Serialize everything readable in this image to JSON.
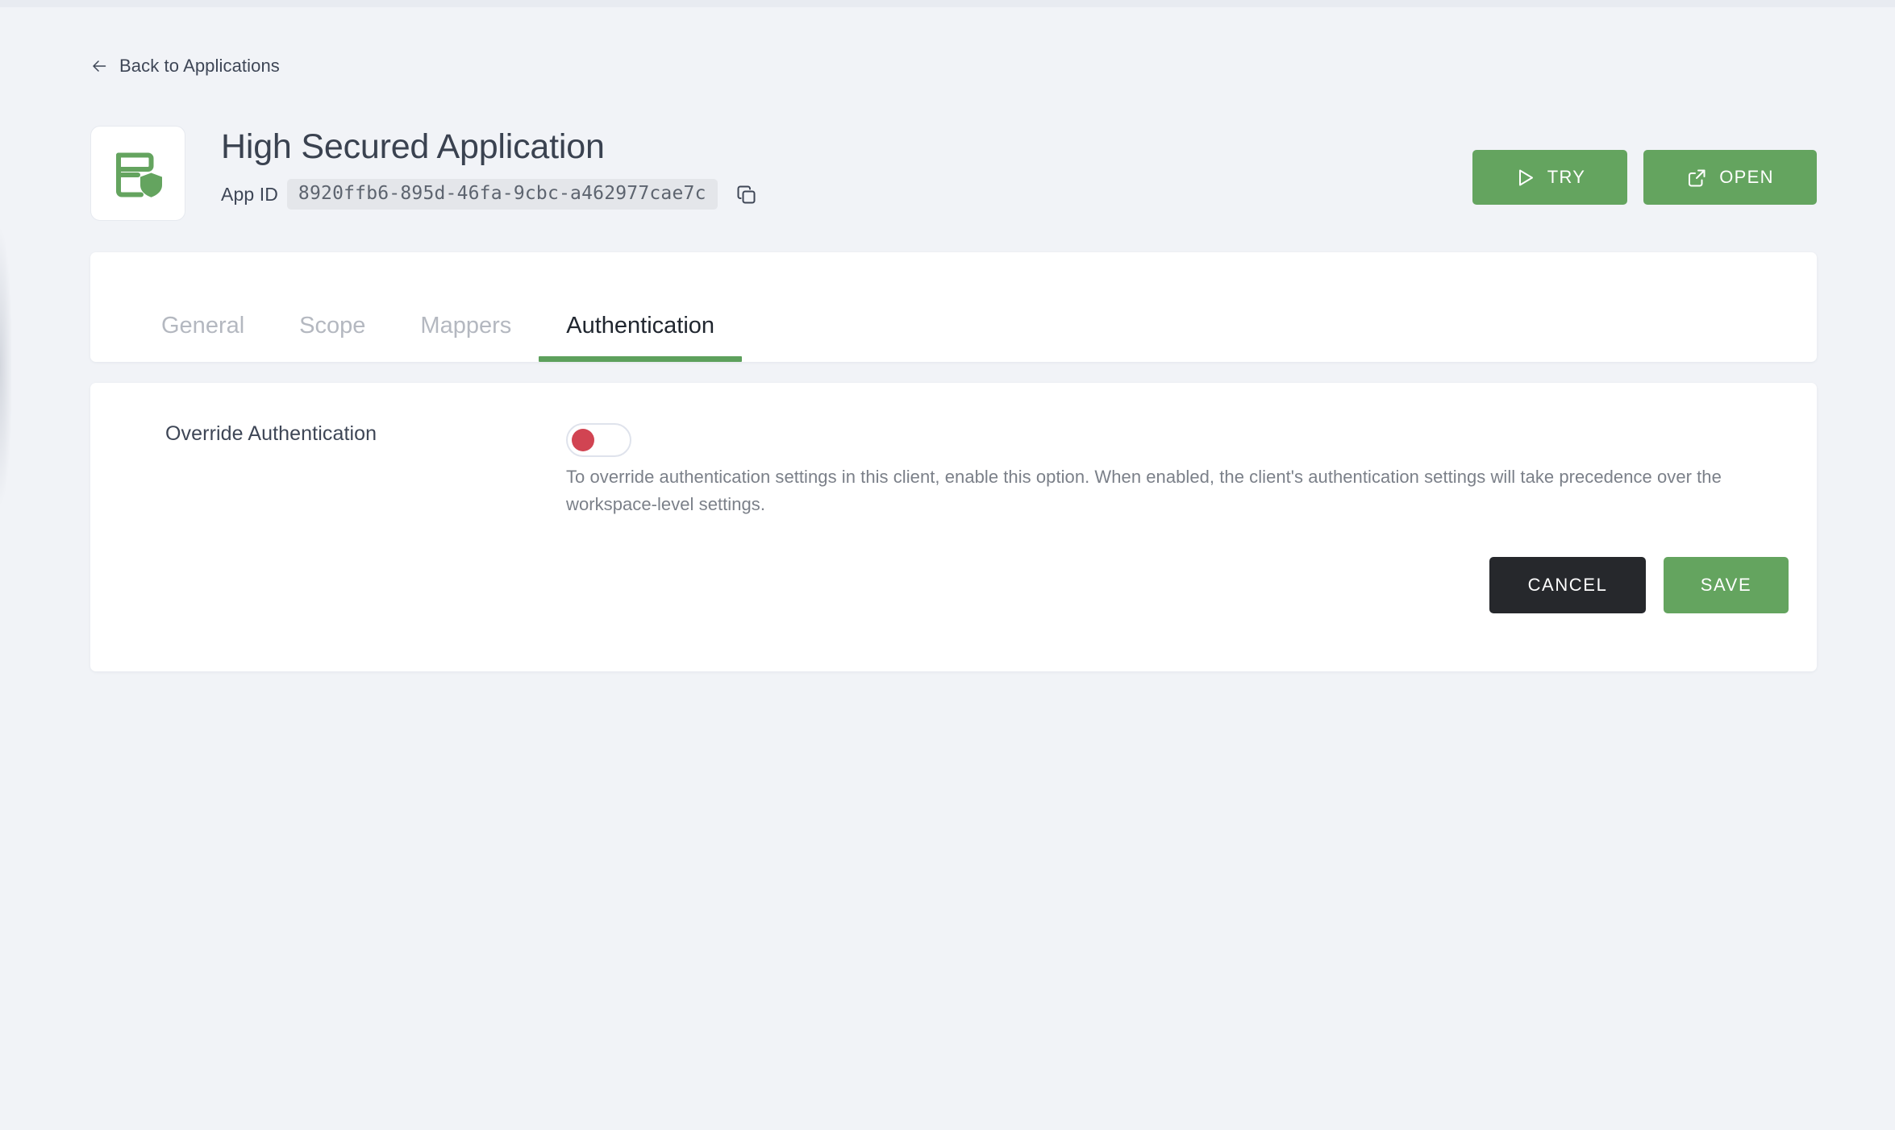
{
  "nav": {
    "back_label": "Back to Applications",
    "back_icon": "arrow-left-icon"
  },
  "header": {
    "app_icon": "list-shield-icon",
    "title": "High Secured Application",
    "app_id_label": "App ID",
    "app_id_value": "8920ffb6-895d-46fa-9cbc-a462977cae7c",
    "copy_icon": "copy-icon",
    "actions": [
      {
        "label": "TRY",
        "icon": "play-icon"
      },
      {
        "label": "OPEN",
        "icon": "external-link-icon"
      }
    ]
  },
  "tabs": [
    {
      "label": "General",
      "active": false
    },
    {
      "label": "Scope",
      "active": false
    },
    {
      "label": "Mappers",
      "active": false
    },
    {
      "label": "Authentication",
      "active": true
    }
  ],
  "settings": {
    "override_auth": {
      "label": "Override Authentication",
      "toggle_state": "off",
      "description": "To override authentication settings in this client, enable this option. When enabled, the client's authentication settings will take precedence over the workspace-level settings."
    },
    "cancel_label": "CANCEL",
    "save_label": "SAVE"
  },
  "colors": {
    "page_background": "#f1f3f7",
    "accent_green": "#64a45f",
    "toggle_knob_red": "#d14452",
    "cancel_dark": "#26282c",
    "text_dark": "#3e4656",
    "text_muted": "#7b8089",
    "tab_inactive": "#b4b8c0"
  }
}
